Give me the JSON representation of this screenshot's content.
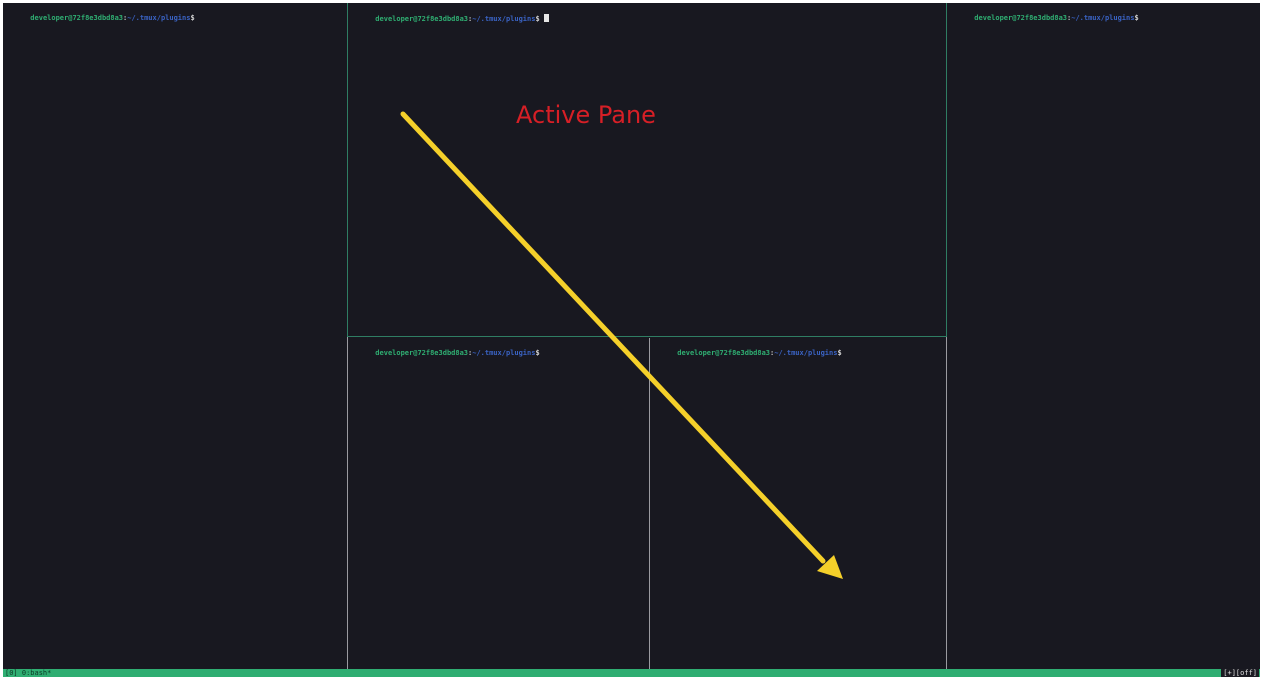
{
  "panes": [
    {
      "id": "left",
      "user_host": "developer@72f8e3dbd8a3",
      "sep": ":",
      "path": "~/.tmux/plugins",
      "dollar": "$"
    },
    {
      "id": "top-middle",
      "user_host": "developer@72f8e3dbd8a3",
      "sep": ":",
      "path": "~/.tmux/plugins",
      "dollar": "$"
    },
    {
      "id": "right",
      "user_host": "developer@72f8e3dbd8a3",
      "sep": ":",
      "path": "~/.tmux/plugins",
      "dollar": "$"
    },
    {
      "id": "bottom-middle-left",
      "user_host": "developer@72f8e3dbd8a3",
      "sep": ":",
      "path": "~/.tmux/plugins",
      "dollar": "$"
    },
    {
      "id": "bottom-middle-right",
      "user_host": "developer@72f8e3dbd8a3",
      "sep": ":",
      "path": "~/.tmux/plugins",
      "dollar": "$"
    }
  ],
  "status_bar": {
    "left": "[0] 0:bash*",
    "right": "[+][off]"
  },
  "annotation": {
    "label": "Active Pane",
    "label_color": "#d71f26",
    "arrow_color": "#f5d02a"
  },
  "colors": {
    "background": "#181820",
    "prompt_user": "#2fae72",
    "prompt_path": "#3a63c4",
    "active_border": "#2f7d63",
    "inactive_border": "#9a9aa0",
    "status_bg": "#2fae72"
  }
}
